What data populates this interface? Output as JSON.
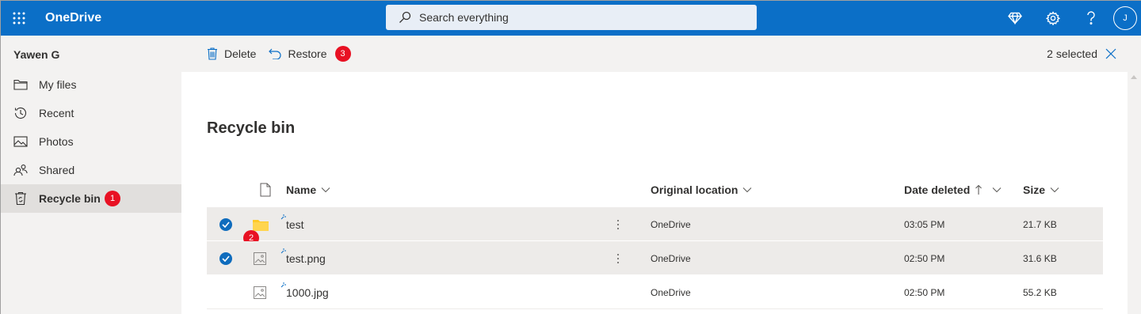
{
  "app": {
    "name": "OneDrive"
  },
  "search": {
    "placeholder": "Search everything"
  },
  "user": {
    "name": "Yawen G",
    "initial": "J"
  },
  "sidebar": {
    "items": [
      {
        "label": "My files",
        "icon": "folder-icon"
      },
      {
        "label": "Recent",
        "icon": "history-icon"
      },
      {
        "label": "Photos",
        "icon": "photo-icon"
      },
      {
        "label": "Shared",
        "icon": "people-icon"
      },
      {
        "label": "Recycle bin",
        "icon": "recycle-bin-icon",
        "active": true,
        "badge": "1"
      }
    ]
  },
  "commands": {
    "delete_label": "Delete",
    "restore_label": "Restore",
    "restore_badge": "3",
    "selected_text": "2 selected"
  },
  "page": {
    "title": "Recycle bin"
  },
  "table": {
    "columns": {
      "name": "Name",
      "location": "Original location",
      "date": "Date deleted",
      "size": "Size"
    },
    "rows": [
      {
        "name": "test",
        "type": "folder",
        "location": "OneDrive",
        "date": "03:05 PM",
        "size": "21.7 KB",
        "selected": true,
        "badge": "2"
      },
      {
        "name": "test.png",
        "type": "image",
        "location": "OneDrive",
        "date": "02:50 PM",
        "size": "31.6 KB",
        "selected": true
      },
      {
        "name": "1000.jpg",
        "type": "image",
        "location": "OneDrive",
        "date": "02:50 PM",
        "size": "55.2 KB",
        "selected": false
      }
    ]
  },
  "colors": {
    "brand": "#0b6fc7",
    "badge": "#e81123",
    "selection": "#edebe9"
  }
}
